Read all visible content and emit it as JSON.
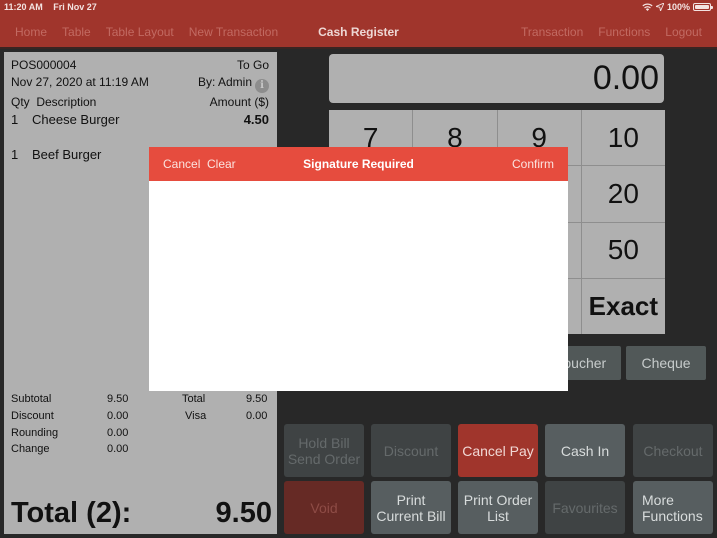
{
  "status_bar": {
    "time": "11:20 AM",
    "date": "Fri Nov 27",
    "wifi_icon": "wifi-icon",
    "location_icon": "location-arrow-icon",
    "battery_pct": "100%",
    "battery_level": 1.0
  },
  "nav": {
    "left_items": [
      "Home",
      "Table",
      "Table Layout",
      "New Transaction"
    ],
    "title": "Cash Register",
    "right_items": [
      "Transaction",
      "Functions",
      "Logout"
    ]
  },
  "receipt": {
    "order_id": "POS000004",
    "order_type": "To Go",
    "datetime": "Nov 27, 2020 at 11:19 AM",
    "by": "By: Admin",
    "info_icon": "i",
    "headers": {
      "qty_desc": "Qty  Description",
      "amount": "Amount ($)"
    },
    "items": [
      {
        "qty": "1",
        "desc": "Cheese Burger",
        "amount": "4.50"
      },
      {
        "qty": "1",
        "desc": "Beef Burger",
        "amount": ""
      }
    ],
    "summary_left": [
      {
        "label": "Subtotal",
        "value": "9.50"
      },
      {
        "label": "Discount",
        "value": "0.00"
      },
      {
        "label": "Rounding",
        "value": "0.00"
      },
      {
        "label": "Change",
        "value": "0.00"
      }
    ],
    "summary_right": [
      {
        "label": "Total",
        "value": "9.50"
      },
      {
        "label": "Visa",
        "value": "0.00"
      }
    ],
    "grand_total_label": "Total (2):",
    "grand_total_value": "9.50"
  },
  "display": {
    "amount": "0.00"
  },
  "keypad": {
    "keys": [
      "7",
      "8",
      "9",
      "10",
      "",
      "",
      "",
      "20",
      "",
      "",
      "",
      "50",
      "",
      "",
      "",
      "Exact"
    ]
  },
  "payment_buttons": {
    "voucher": "Voucher",
    "cheque": "Cheque"
  },
  "functions": {
    "row1": [
      "Hold Bill\nSend Order",
      "Discount",
      "Cancel Pay",
      "Cash In",
      "Checkout"
    ],
    "row2": [
      "Void",
      "Print\nCurrent Bill",
      "Print Order\nList",
      "Favourites",
      "More\nFunctions"
    ]
  },
  "modal": {
    "cancel": "Cancel",
    "clear": "Clear",
    "title": "Signature Required",
    "confirm": "Confirm"
  },
  "colors": {
    "brand_red": "#a0352c",
    "modal_header": "#e64c3e"
  }
}
